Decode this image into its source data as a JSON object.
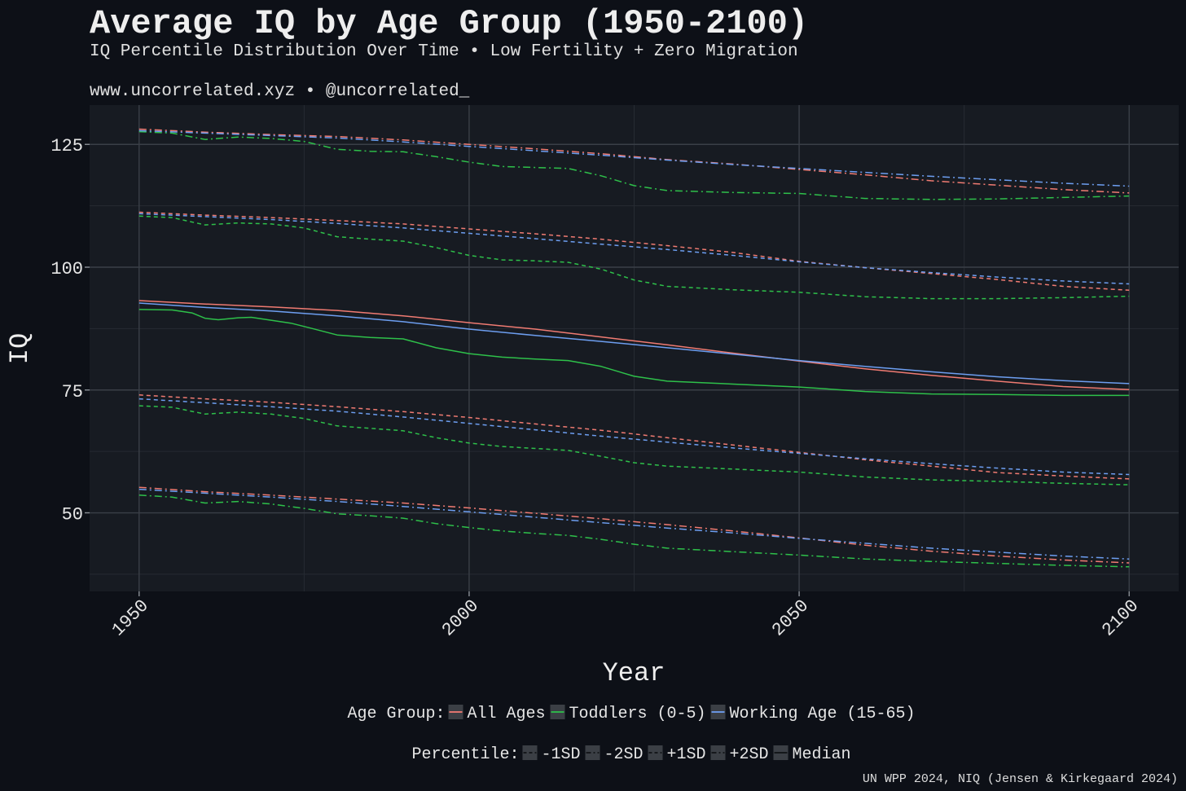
{
  "colors": {
    "page_bg": "#0d1017",
    "panel_bg": "#171b22",
    "text": "#e6e6e6",
    "gridline": "#3a3f47",
    "All Ages": "#f07b72",
    "Toddlers (0-5)": "#2ec04a",
    "Working Age (15-65)": "#6d9ef0"
  },
  "chart_data": {
    "type": "line",
    "title": "Average IQ by Age Group (1950-2100)",
    "subtitle": "IQ Percentile Distribution Over Time • Low Fertility + Zero Migration",
    "subtitle_line2": "www.uncorrelated.xyz • @uncorrelated_",
    "xlabel": "Year",
    "ylabel": "IQ",
    "caption": "UN WPP 2024, NIQ (Jensen & Kirkegaard 2024)",
    "xlim": [
      1942.5,
      2107.5
    ],
    "ylim": [
      34,
      133
    ],
    "x_ticks": [
      1950,
      2000,
      2050,
      2100
    ],
    "y_ticks": [
      50,
      75,
      100,
      125
    ],
    "grid": true,
    "legend_position": "bottom",
    "legend": {
      "color_title": "Age Group:",
      "color_items": [
        "All Ages",
        "Toddlers (0-5)",
        "Working Age (15-65)"
      ],
      "linetype_title": "Percentile:",
      "linetype_items": [
        "-1SD",
        "-2SD",
        "+1SD",
        "+2SD",
        "Median"
      ]
    },
    "series": [
      {
        "name": "All Ages",
        "percentile": "+2SD",
        "points": [
          [
            1950,
            128.1
          ],
          [
            1960,
            127.5
          ],
          [
            1970,
            127.0
          ],
          [
            1980,
            126.6
          ],
          [
            1990,
            125.9
          ],
          [
            2000,
            125.0
          ],
          [
            2010,
            124.1
          ],
          [
            2020,
            123.1
          ],
          [
            2030,
            121.9
          ],
          [
            2040,
            121.0
          ],
          [
            2050,
            119.9
          ],
          [
            2060,
            118.8
          ],
          [
            2070,
            117.6
          ],
          [
            2080,
            116.7
          ],
          [
            2090,
            115.8
          ],
          [
            2100,
            115.1
          ]
        ]
      },
      {
        "name": "All Ages",
        "percentile": "+1SD",
        "points": [
          [
            1950,
            111.2
          ],
          [
            1960,
            110.6
          ],
          [
            1970,
            110.1
          ],
          [
            1980,
            109.5
          ],
          [
            1990,
            108.8
          ],
          [
            2000,
            107.8
          ],
          [
            2010,
            106.8
          ],
          [
            2020,
            105.7
          ],
          [
            2030,
            104.4
          ],
          [
            2040,
            103.0
          ],
          [
            2050,
            101.2
          ],
          [
            2060,
            99.9
          ],
          [
            2070,
            98.7
          ],
          [
            2080,
            97.5
          ],
          [
            2090,
            96.1
          ],
          [
            2100,
            95.3
          ]
        ]
      },
      {
        "name": "All Ages",
        "percentile": "Median",
        "points": [
          [
            1950,
            93.2
          ],
          [
            1960,
            92.5
          ],
          [
            1970,
            91.9
          ],
          [
            1980,
            91.2
          ],
          [
            1990,
            90.1
          ],
          [
            2000,
            88.7
          ],
          [
            2010,
            87.4
          ],
          [
            2020,
            85.8
          ],
          [
            2030,
            84.2
          ],
          [
            2040,
            82.5
          ],
          [
            2050,
            80.9
          ],
          [
            2060,
            79.3
          ],
          [
            2070,
            78.0
          ],
          [
            2080,
            76.8
          ],
          [
            2090,
            75.7
          ],
          [
            2100,
            75.1
          ]
        ]
      },
      {
        "name": "All Ages",
        "percentile": "-1SD",
        "points": [
          [
            1950,
            74.0
          ],
          [
            1960,
            73.2
          ],
          [
            1970,
            72.5
          ],
          [
            1980,
            71.6
          ],
          [
            1990,
            70.6
          ],
          [
            2000,
            69.4
          ],
          [
            2010,
            68.1
          ],
          [
            2020,
            66.8
          ],
          [
            2030,
            65.3
          ],
          [
            2040,
            63.8
          ],
          [
            2050,
            62.3
          ],
          [
            2060,
            60.8
          ],
          [
            2070,
            59.5
          ],
          [
            2080,
            58.2
          ],
          [
            2090,
            57.5
          ],
          [
            2100,
            56.9
          ]
        ]
      },
      {
        "name": "All Ages",
        "percentile": "-2SD",
        "points": [
          [
            1950,
            55.2
          ],
          [
            1960,
            54.3
          ],
          [
            1970,
            53.6
          ],
          [
            1980,
            52.8
          ],
          [
            1990,
            52.0
          ],
          [
            2000,
            51.0
          ],
          [
            2010,
            49.9
          ],
          [
            2020,
            48.8
          ],
          [
            2030,
            47.6
          ],
          [
            2040,
            46.3
          ],
          [
            2050,
            44.9
          ],
          [
            2060,
            43.4
          ],
          [
            2070,
            42.2
          ],
          [
            2080,
            41.2
          ],
          [
            2090,
            40.4
          ],
          [
            2100,
            39.8
          ]
        ]
      },
      {
        "name": "Toddlers (0-5)",
        "percentile": "+2SD",
        "points": [
          [
            1950,
            127.6
          ],
          [
            1955,
            127.3
          ],
          [
            1960,
            126.0
          ],
          [
            1965,
            126.5
          ],
          [
            1970,
            126.2
          ],
          [
            1975,
            125.6
          ],
          [
            1980,
            124.0
          ],
          [
            1985,
            123.6
          ],
          [
            1990,
            123.5
          ],
          [
            1995,
            122.5
          ],
          [
            2000,
            121.4
          ],
          [
            2005,
            120.5
          ],
          [
            2010,
            120.3
          ],
          [
            2015,
            120.1
          ],
          [
            2020,
            118.6
          ],
          [
            2025,
            116.6
          ],
          [
            2030,
            115.6
          ],
          [
            2040,
            115.2
          ],
          [
            2050,
            115.0
          ],
          [
            2060,
            114.0
          ],
          [
            2070,
            113.8
          ],
          [
            2080,
            113.9
          ],
          [
            2090,
            114.2
          ],
          [
            2100,
            114.5
          ]
        ]
      },
      {
        "name": "Toddlers (0-5)",
        "percentile": "+1SD",
        "points": [
          [
            1950,
            110.4
          ],
          [
            1955,
            110.1
          ],
          [
            1960,
            108.6
          ],
          [
            1965,
            109.0
          ],
          [
            1970,
            108.8
          ],
          [
            1975,
            108.0
          ],
          [
            1980,
            106.2
          ],
          [
            1985,
            105.7
          ],
          [
            1990,
            105.3
          ],
          [
            1995,
            104.0
          ],
          [
            2000,
            102.4
          ],
          [
            2005,
            101.5
          ],
          [
            2010,
            101.3
          ],
          [
            2015,
            101.0
          ],
          [
            2020,
            99.6
          ],
          [
            2025,
            97.4
          ],
          [
            2030,
            96.1
          ],
          [
            2040,
            95.4
          ],
          [
            2050,
            94.9
          ],
          [
            2060,
            94.0
          ],
          [
            2070,
            93.6
          ],
          [
            2080,
            93.6
          ],
          [
            2090,
            93.8
          ],
          [
            2100,
            94.1
          ]
        ]
      },
      {
        "name": "Toddlers (0-5)",
        "percentile": "Median",
        "points": [
          [
            1950,
            91.4
          ],
          [
            1955,
            91.3
          ],
          [
            1958,
            90.7
          ],
          [
            1960,
            89.6
          ],
          [
            1962,
            89.3
          ],
          [
            1965,
            89.7
          ],
          [
            1967,
            89.8
          ],
          [
            1970,
            89.2
          ],
          [
            1973,
            88.6
          ],
          [
            1976,
            87.6
          ],
          [
            1980,
            86.2
          ],
          [
            1985,
            85.7
          ],
          [
            1990,
            85.4
          ],
          [
            1995,
            83.6
          ],
          [
            2000,
            82.4
          ],
          [
            2005,
            81.7
          ],
          [
            2010,
            81.3
          ],
          [
            2015,
            81.0
          ],
          [
            2020,
            79.8
          ],
          [
            2025,
            77.8
          ],
          [
            2030,
            76.8
          ],
          [
            2040,
            76.2
          ],
          [
            2050,
            75.6
          ],
          [
            2060,
            74.7
          ],
          [
            2070,
            74.2
          ],
          [
            2080,
            74.1
          ],
          [
            2090,
            73.9
          ],
          [
            2100,
            73.9
          ]
        ]
      },
      {
        "name": "Toddlers (0-5)",
        "percentile": "-1SD",
        "points": [
          [
            1950,
            71.8
          ],
          [
            1955,
            71.5
          ],
          [
            1960,
            70.1
          ],
          [
            1965,
            70.5
          ],
          [
            1970,
            70.1
          ],
          [
            1975,
            69.2
          ],
          [
            1980,
            67.7
          ],
          [
            1985,
            67.2
          ],
          [
            1990,
            66.7
          ],
          [
            1995,
            65.3
          ],
          [
            2000,
            64.2
          ],
          [
            2005,
            63.5
          ],
          [
            2010,
            63.1
          ],
          [
            2015,
            62.7
          ],
          [
            2020,
            61.5
          ],
          [
            2025,
            60.2
          ],
          [
            2030,
            59.5
          ],
          [
            2040,
            58.9
          ],
          [
            2050,
            58.3
          ],
          [
            2060,
            57.3
          ],
          [
            2070,
            56.7
          ],
          [
            2080,
            56.4
          ],
          [
            2090,
            56.0
          ],
          [
            2100,
            55.7
          ]
        ]
      },
      {
        "name": "Toddlers (0-5)",
        "percentile": "-2SD",
        "points": [
          [
            1950,
            53.6
          ],
          [
            1955,
            53.2
          ],
          [
            1960,
            52.0
          ],
          [
            1965,
            52.3
          ],
          [
            1970,
            51.8
          ],
          [
            1975,
            50.9
          ],
          [
            1980,
            49.8
          ],
          [
            1985,
            49.4
          ],
          [
            1990,
            48.9
          ],
          [
            1995,
            47.8
          ],
          [
            2000,
            47.0
          ],
          [
            2005,
            46.3
          ],
          [
            2010,
            45.8
          ],
          [
            2015,
            45.4
          ],
          [
            2020,
            44.6
          ],
          [
            2025,
            43.6
          ],
          [
            2030,
            42.8
          ],
          [
            2040,
            42.1
          ],
          [
            2050,
            41.4
          ],
          [
            2060,
            40.6
          ],
          [
            2070,
            40.1
          ],
          [
            2080,
            39.7
          ],
          [
            2090,
            39.3
          ],
          [
            2100,
            39.0
          ]
        ]
      },
      {
        "name": "Working Age (15-65)",
        "percentile": "+2SD",
        "points": [
          [
            1950,
            127.8
          ],
          [
            1960,
            127.3
          ],
          [
            1970,
            126.8
          ],
          [
            1980,
            126.3
          ],
          [
            1990,
            125.5
          ],
          [
            2000,
            124.6
          ],
          [
            2010,
            123.7
          ],
          [
            2020,
            122.8
          ],
          [
            2030,
            121.8
          ],
          [
            2040,
            120.9
          ],
          [
            2050,
            120.1
          ],
          [
            2060,
            119.3
          ],
          [
            2070,
            118.5
          ],
          [
            2080,
            117.8
          ],
          [
            2090,
            117.1
          ],
          [
            2100,
            116.5
          ]
        ]
      },
      {
        "name": "Working Age (15-65)",
        "percentile": "+1SD",
        "points": [
          [
            1950,
            110.9
          ],
          [
            1960,
            110.3
          ],
          [
            1970,
            109.7
          ],
          [
            1980,
            108.9
          ],
          [
            1990,
            108.0
          ],
          [
            2000,
            106.9
          ],
          [
            2010,
            105.8
          ],
          [
            2020,
            104.7
          ],
          [
            2030,
            103.6
          ],
          [
            2040,
            102.4
          ],
          [
            2050,
            101.1
          ],
          [
            2060,
            99.9
          ],
          [
            2070,
            98.9
          ],
          [
            2080,
            98.0
          ],
          [
            2090,
            97.2
          ],
          [
            2100,
            96.6
          ]
        ]
      },
      {
        "name": "Working Age (15-65)",
        "percentile": "Median",
        "points": [
          [
            1950,
            92.7
          ],
          [
            1960,
            91.8
          ],
          [
            1970,
            91.1
          ],
          [
            1980,
            90.1
          ],
          [
            1990,
            88.9
          ],
          [
            2000,
            87.4
          ],
          [
            2010,
            86.1
          ],
          [
            2020,
            84.9
          ],
          [
            2030,
            83.6
          ],
          [
            2040,
            82.3
          ],
          [
            2050,
            81.0
          ],
          [
            2060,
            79.8
          ],
          [
            2070,
            78.7
          ],
          [
            2080,
            77.7
          ],
          [
            2090,
            76.9
          ],
          [
            2100,
            76.3
          ]
        ]
      },
      {
        "name": "Working Age (15-65)",
        "percentile": "-1SD",
        "points": [
          [
            1950,
            73.2
          ],
          [
            1960,
            72.4
          ],
          [
            1970,
            71.6
          ],
          [
            1980,
            70.7
          ],
          [
            1990,
            69.5
          ],
          [
            2000,
            68.2
          ],
          [
            2010,
            66.9
          ],
          [
            2020,
            65.6
          ],
          [
            2030,
            64.4
          ],
          [
            2040,
            63.2
          ],
          [
            2050,
            62.1
          ],
          [
            2060,
            61.0
          ],
          [
            2070,
            60.0
          ],
          [
            2080,
            59.1
          ],
          [
            2090,
            58.3
          ],
          [
            2100,
            57.8
          ]
        ]
      },
      {
        "name": "Working Age (15-65)",
        "percentile": "-2SD",
        "points": [
          [
            1950,
            54.8
          ],
          [
            1960,
            54.0
          ],
          [
            1970,
            53.2
          ],
          [
            1980,
            52.3
          ],
          [
            1990,
            51.3
          ],
          [
            2000,
            50.2
          ],
          [
            2010,
            49.1
          ],
          [
            2020,
            48.0
          ],
          [
            2030,
            46.9
          ],
          [
            2040,
            45.9
          ],
          [
            2050,
            44.8
          ],
          [
            2060,
            43.8
          ],
          [
            2070,
            42.8
          ],
          [
            2080,
            42.0
          ],
          [
            2090,
            41.2
          ],
          [
            2100,
            40.6
          ]
        ]
      }
    ]
  }
}
